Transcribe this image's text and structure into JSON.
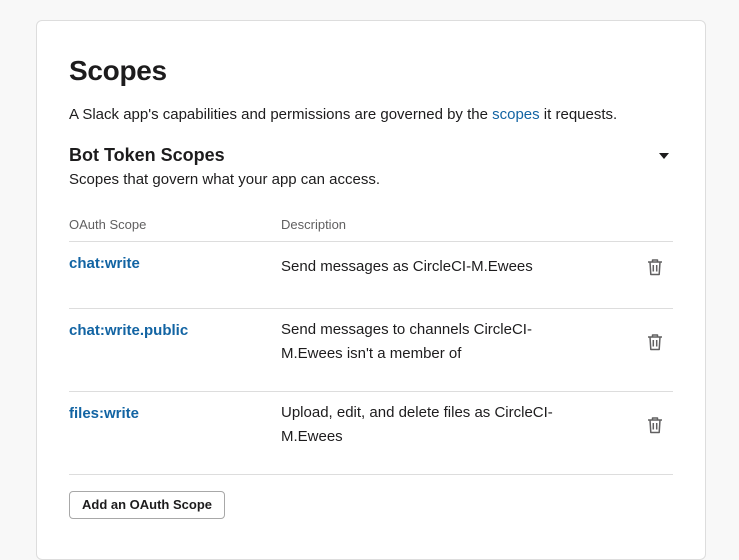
{
  "section": {
    "title": "Scopes",
    "intro_before": "A Slack app's capabilities and permissions are governed by the ",
    "intro_link": "scopes",
    "intro_after": " it requests."
  },
  "bot_token": {
    "title": "Bot Token Scopes",
    "subtitle": "Scopes that govern what your app can access.",
    "toggle_icon": "caret-down-icon"
  },
  "table": {
    "columns": [
      "OAuth Scope",
      "Description"
    ],
    "rows": [
      {
        "scope": "chat:write",
        "description": "Send messages as CircleCI-M.Ewees",
        "action_icon": "trash-icon"
      },
      {
        "scope": "chat:write.public",
        "description": "Send messages to channels CircleCI-M.Ewees isn't a member of",
        "action_icon": "trash-icon"
      },
      {
        "scope": "files:write",
        "description": "Upload, edit, and delete files as CircleCI-M.Ewees",
        "action_icon": "trash-icon"
      }
    ]
  },
  "add_button_label": "Add an OAuth Scope",
  "colors": {
    "link": "#1264a3",
    "text": "#1d1c1d",
    "muted": "#616061",
    "border": "#dddddd"
  }
}
